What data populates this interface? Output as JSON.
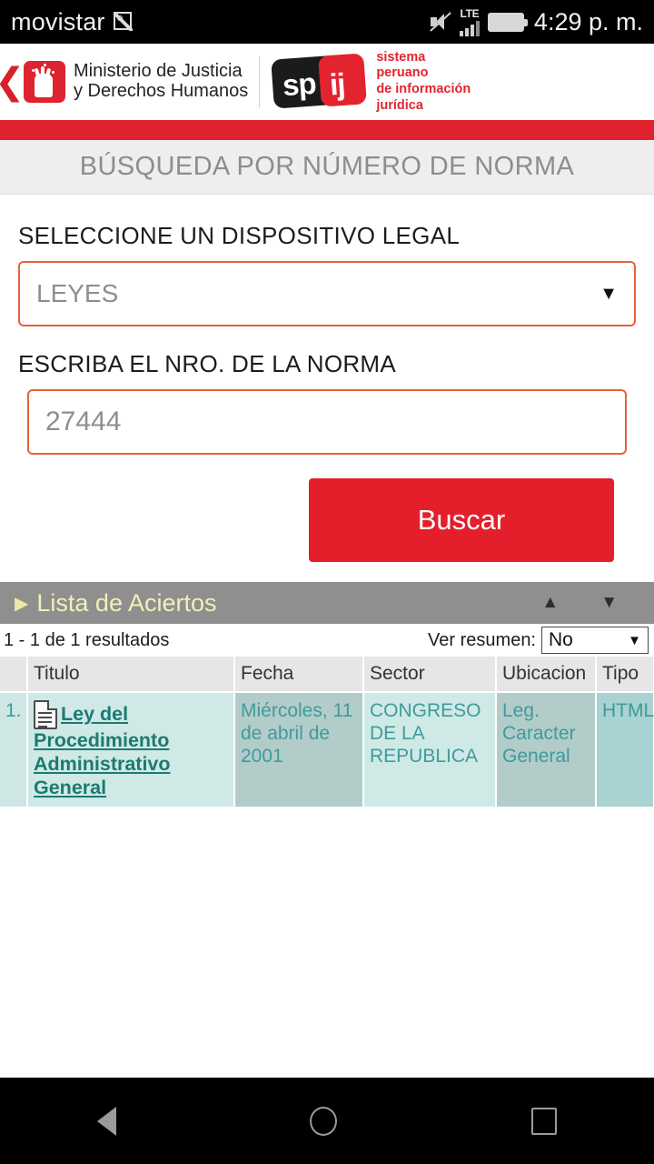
{
  "statusbar": {
    "carrier": "movistar",
    "carrier_badge_icon": "sim-photo-icon",
    "mute_icon": "volume-mute-icon",
    "network_label": "LTE",
    "signal_icon": "signal-bars-icon",
    "battery_icon": "battery-icon",
    "clock": "4:29 p. m."
  },
  "header": {
    "back_icon": "back-chevron-icon",
    "ministry_logo_icon": "ministry-hand-logo-icon",
    "ministry_line1": "Ministerio de Justicia",
    "ministry_line2": "y Derechos Humanos",
    "spij_mark_left": "sp",
    "spij_mark_right": "ij",
    "spij_line1": "sistema",
    "spij_line2": "peruano",
    "spij_line3": "de información",
    "spij_line4": "jurídica"
  },
  "section": {
    "title": "BÚSQUEDA POR NÚMERO DE NORMA"
  },
  "form": {
    "device_label": "SELECCIONE UN DISPOSITIVO LEGAL",
    "device_value": "LEYES",
    "device_caret": "▼",
    "number_label": "ESCRIBA EL NRO. DE LA NORMA",
    "number_value": "27444",
    "search_button": "Buscar"
  },
  "results": {
    "panel_title": "Lista de Aciertos",
    "panel_triangle": "▶",
    "scroll_up_icon": "▲",
    "scroll_down_icon": "▼",
    "count_text": "1 - 1 de 1 resultados",
    "summary_label": "Ver resumen:",
    "summary_value": "No",
    "summary_caret": "▼",
    "columns": [
      "",
      "Titulo",
      "Fecha",
      "Sector",
      "Ubicacion",
      "Tipo"
    ],
    "rows": [
      {
        "num": "1.",
        "doc_icon": "document-icon",
        "titulo": "Ley del Procedimiento Administrativo General",
        "fecha": "Miércoles, 11 de abril de 2001",
        "sector": "CONGRESO DE LA REPUBLICA",
        "ubicacion": "Leg. Caracter General",
        "tipo": "HTML"
      }
    ]
  },
  "navbar": {
    "back_icon": "android-back-icon",
    "home_icon": "android-home-icon",
    "recents_icon": "android-recents-icon"
  },
  "colors": {
    "brand_red": "#e0232e",
    "button_red": "#e41e2b",
    "accent_orange": "#e8613c",
    "panel_gray": "#8f8f8f",
    "teal_text": "#3f9b9b",
    "link_teal": "#1c7a72"
  }
}
